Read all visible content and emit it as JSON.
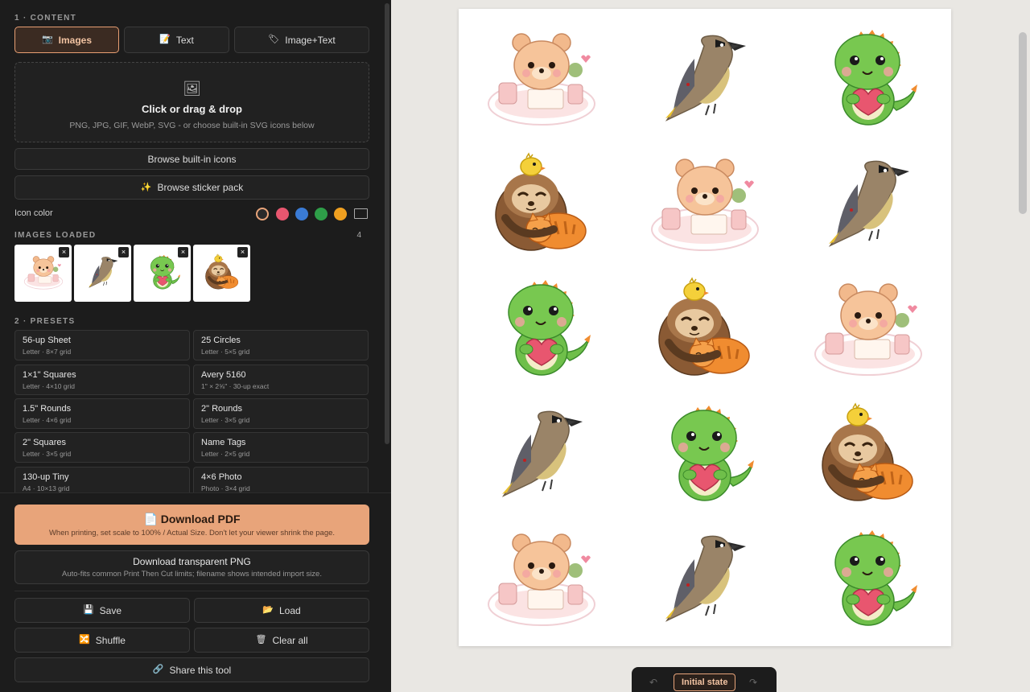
{
  "sidebar": {
    "content_heading": "1 · CONTENT",
    "content_tabs": [
      {
        "label": "Images",
        "icon": "camera-icon",
        "glyph": "📷",
        "active": true
      },
      {
        "label": "Text",
        "icon": "document-icon",
        "glyph": "📝",
        "active": false
      },
      {
        "label": "Image+Text",
        "icon": "tag-icon",
        "glyph": "🏷",
        "active": false
      }
    ],
    "dropzone": {
      "icon": "picture-icon",
      "glyph": "🖼",
      "title": "Click or drag & drop",
      "subtitle": "PNG, JPG, GIF, WebP, SVG - or choose built-in SVG icons below"
    },
    "browse_icons_label": "Browse built-in icons",
    "browse_stickers_label": "Browse sticker pack",
    "browse_stickers_glyph": "✨",
    "icon_color_label": "Icon color",
    "icon_colors": [
      "#2a2a2a",
      "#e8566f",
      "#3a7bd5",
      "#2e9e48",
      "#f0a020",
      "#ffffff"
    ],
    "images_heading": "IMAGES LOADED",
    "images_count": "4",
    "images": [
      {
        "name": "bear-sticker"
      },
      {
        "name": "waxwing-sticker"
      },
      {
        "name": "dino-sticker"
      },
      {
        "name": "sloth-sticker"
      }
    ],
    "remove_glyph": "×",
    "presets_heading": "2 · PRESETS",
    "presets": [
      {
        "name": "56-up Sheet",
        "desc": "Letter · 8×7 grid"
      },
      {
        "name": "25 Circles",
        "desc": "Letter · 5×5 grid"
      },
      {
        "name": "1×1\" Squares",
        "desc": "Letter · 4×10 grid"
      },
      {
        "name": "Avery 5160",
        "desc": "1\" × 2⅝\" · 30-up exact"
      },
      {
        "name": "1.5\" Rounds",
        "desc": "Letter · 4×6 grid"
      },
      {
        "name": "2\" Rounds",
        "desc": "Letter · 3×5 grid"
      },
      {
        "name": "2\" Squares",
        "desc": "Letter · 3×5 grid"
      },
      {
        "name": "Name Tags",
        "desc": "Letter · 2×5 grid"
      },
      {
        "name": "130-up Tiny",
        "desc": "A4 · 10×13 grid"
      },
      {
        "name": "4×6 Photo",
        "desc": "Photo · 3×4 grid"
      }
    ]
  },
  "actions": {
    "pdf_icon": "📄",
    "pdf_label": "Download PDF",
    "pdf_note": "When printing, set scale to 100% / Actual Size. Don't let your viewer shrink the page.",
    "png_label": "Download transparent PNG",
    "png_note": "Auto-fits common Print Then Cut limits; filename shows intended import size.",
    "save_label": "Save",
    "save_glyph": "💾",
    "load_label": "Load",
    "load_glyph": "📂",
    "shuffle_label": "Shuffle",
    "shuffle_glyph": "🔀",
    "clear_label": "Clear all",
    "clear_glyph": "🗑",
    "share_label": "Share this tool",
    "share_glyph": "🔗"
  },
  "preview": {
    "grid_cols": 3,
    "grid_rows": 5,
    "sequence": [
      "bear",
      "bird",
      "dino",
      "sloth",
      "bear",
      "bird",
      "dino",
      "sloth",
      "bear",
      "bird",
      "dino",
      "sloth",
      "bear",
      "bird",
      "dino"
    ]
  },
  "history": {
    "undo_glyph": "↶",
    "redo_glyph": "↷",
    "state_label": "Initial state"
  }
}
